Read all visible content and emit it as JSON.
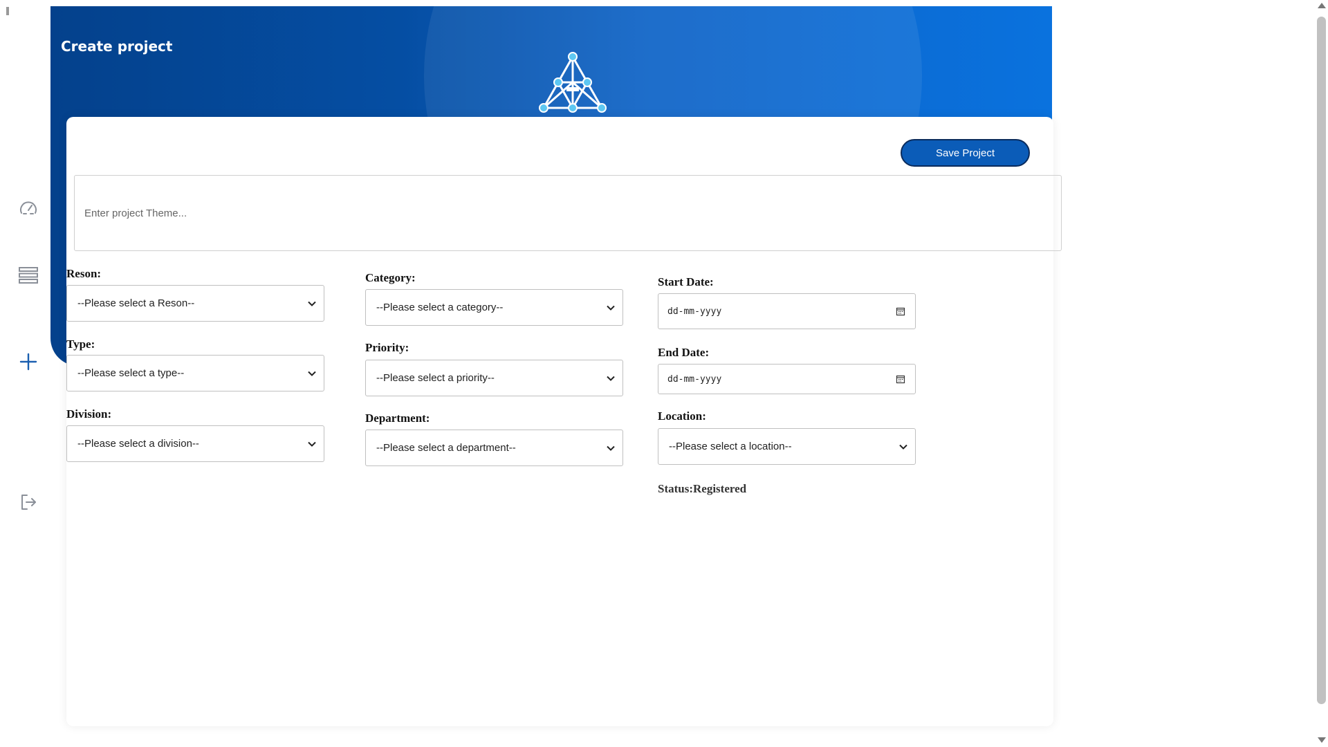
{
  "header": {
    "title": "Create project",
    "colors": {
      "banner_dark": "#04418c",
      "banner_light": "#0a72de",
      "accent_button": "#0b5cb8"
    }
  },
  "sidebar": {
    "icons": [
      "dashboard-gauge-icon",
      "list-icon",
      "plus-icon",
      "logout-icon"
    ]
  },
  "toolbar": {
    "save_label": "Save Project"
  },
  "theme": {
    "placeholder": "Enter project Theme...",
    "value": ""
  },
  "form": {
    "reson": {
      "label": "Reson:",
      "value": "--Please select a Reson--"
    },
    "type": {
      "label": "Type:",
      "value": "--Please select a type--"
    },
    "division": {
      "label": "Division:",
      "value": "--Please select a division--"
    },
    "category": {
      "label": "Category:",
      "value": "--Please select a category--"
    },
    "priority": {
      "label": "Priority:",
      "value": "--Please select a priority--"
    },
    "department": {
      "label": "Department:",
      "value": "--Please select a department--"
    },
    "start_date": {
      "label": "Start Date:",
      "value": "dd-mm-yyyy"
    },
    "end_date": {
      "label": "End Date:",
      "value": "dd-mm-yyyy"
    },
    "location": {
      "label": "Location:",
      "value": "--Please select a location--"
    }
  },
  "status": {
    "text": "Status:Registered"
  }
}
